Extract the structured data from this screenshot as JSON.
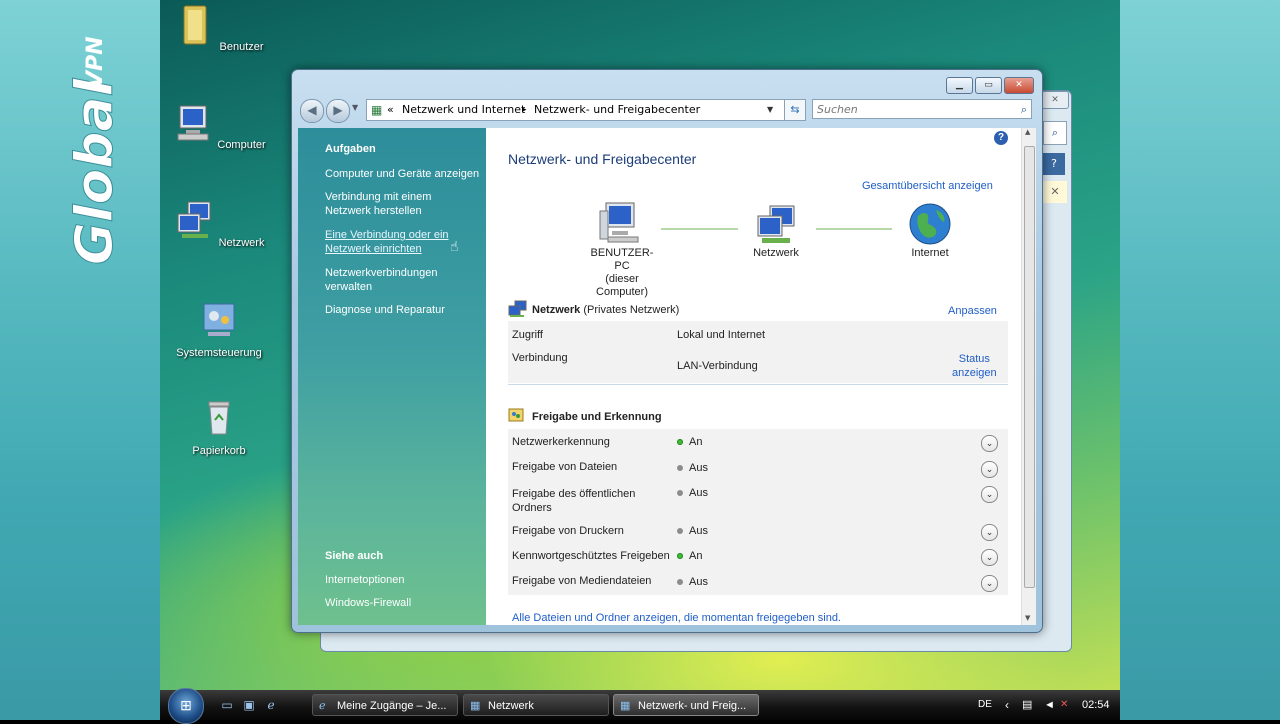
{
  "overlay": {
    "logo_text": "Global VPN"
  },
  "desktop": {
    "icons": [
      {
        "label": "Benutzer",
        "icon": "folder-icon"
      },
      {
        "label": "Computer",
        "icon": "computer-icon"
      },
      {
        "label": "Netzwerk",
        "icon": "network-icon"
      },
      {
        "label": "Systemsteuerung",
        "icon": "control-panel-icon"
      },
      {
        "label": "Papierkorb",
        "icon": "recycle-bin-icon"
      }
    ]
  },
  "window": {
    "address": {
      "chevron": "«",
      "part1": "Netzwerk und Internet",
      "sep": "▸",
      "part2": "Netzwerk- und Freigabecenter"
    },
    "search_placeholder": "Suchen",
    "help": "?",
    "sidebar": {
      "tasks_title": "Aufgaben",
      "tasks": [
        "Computer und Geräte anzeigen",
        "Verbindung mit einem Netzwerk herstellen",
        "Eine Verbindung oder ein Netzwerk einrichten",
        "Netzwerkverbindungen verwalten",
        "Diagnose und Reparatur"
      ],
      "see_also_title": "Siehe auch",
      "see_also": [
        "Internetoptionen",
        "Windows-Firewall"
      ]
    },
    "main": {
      "title": "Netzwerk- und Freigabecenter",
      "overview_link": "Gesamtübersicht anzeigen",
      "map": {
        "computer_name": "BENUTZER-PC",
        "computer_sub": "(dieser Computer)",
        "network": "Netzwerk",
        "internet": "Internet"
      },
      "network_section": {
        "name": "Netzwerk",
        "type": "(Privates Netzwerk)",
        "customize": "Anpassen",
        "access_label": "Zugriff",
        "access_value": "Lokal und Internet",
        "connection_label": "Verbindung",
        "connection_value": "LAN-Verbindung",
        "status_link_1": "Status",
        "status_link_2": "anzeigen"
      },
      "sharing_title": "Freigabe und Erkennung",
      "sharing": [
        {
          "label": "Netzwerkerkennung",
          "value": "An",
          "on": true
        },
        {
          "label": "Freigabe von Dateien",
          "value": "Aus",
          "on": false
        },
        {
          "label": "Freigabe des öffentlichen Ordners",
          "value": "Aus",
          "on": false
        },
        {
          "label": "Freigabe von Druckern",
          "value": "Aus",
          "on": false
        },
        {
          "label": "Kennwortgeschütztes Freigeben",
          "value": "An",
          "on": true
        },
        {
          "label": "Freigabe von Mediendateien",
          "value": "Aus",
          "on": false
        }
      ],
      "bottom_link": "Alle Dateien und Ordner anzeigen, die momentan freigegeben sind."
    }
  },
  "taskbar": {
    "buttons": [
      {
        "label": "Meine Zugänge – Je..."
      },
      {
        "label": "Netzwerk"
      },
      {
        "label": "Netzwerk- und Freig..."
      }
    ],
    "lang": "DE",
    "time": "02:54"
  }
}
